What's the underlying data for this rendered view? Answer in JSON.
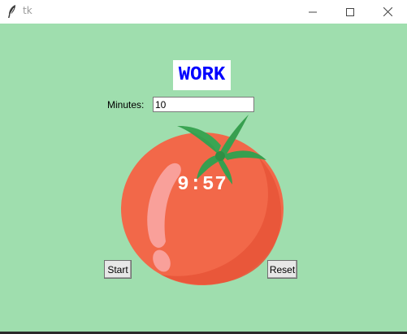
{
  "window": {
    "title": "tk",
    "controls": [
      "minimize-icon",
      "maximize-icon",
      "close-icon"
    ]
  },
  "colors": {
    "background": "#9fdeae",
    "mode_text": "#0000ff",
    "tomato": "#f26849",
    "leaf": "#379f4f"
  },
  "header": {
    "mode_label": "WORK"
  },
  "minutes": {
    "label": "Minutes:",
    "value": "10"
  },
  "timer": {
    "display": "9:57"
  },
  "buttons": {
    "start_label": "Start",
    "reset_label": "Reset"
  }
}
